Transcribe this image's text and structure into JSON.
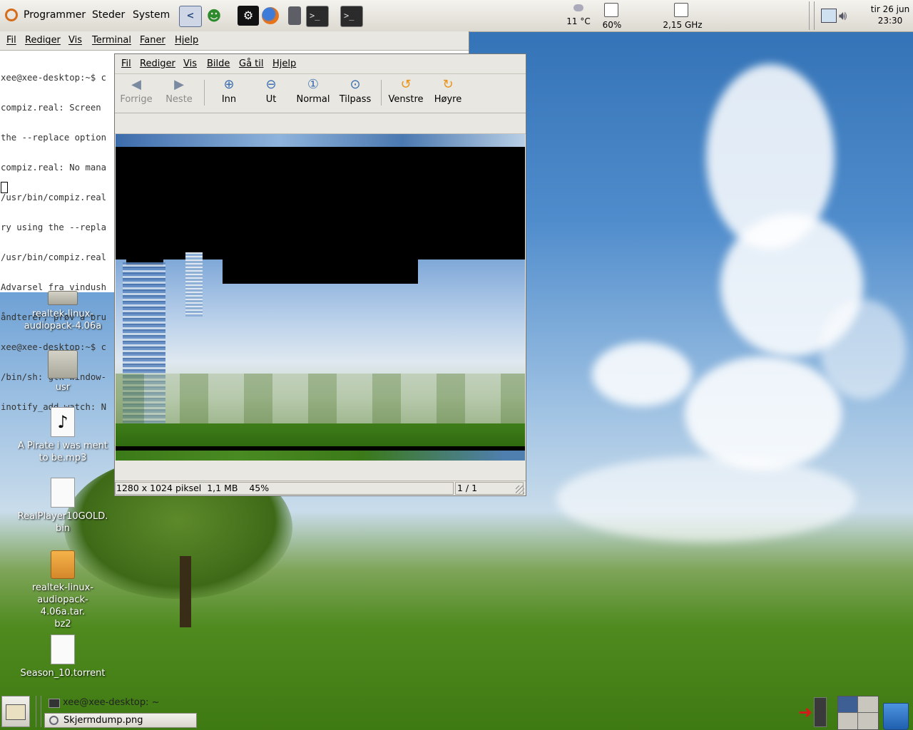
{
  "top_panel": {
    "menus": [
      "Programmer",
      "Steder",
      "System"
    ],
    "launchers": [
      "kde-icon",
      "messenger-icon",
      "steam-icon",
      "firefox-icon",
      "speaker-icon",
      "terminal-icon",
      "terminal-icon"
    ],
    "weather": "11 °C",
    "cpu_usage": "60%",
    "cpu_freq": "2,15 GHz",
    "date": "tir 26 jun",
    "time": "23:30"
  },
  "terminal": {
    "menus": [
      "Fil",
      "Rediger",
      "Vis",
      "Terminal",
      "Faner",
      "Hjelp"
    ],
    "lines": [
      "xee@xee-desktop:~$ c",
      "compiz.real: Screen ",
      "the --replace option",
      "compiz.real: No mana",
      "/usr/bin/compiz.real",
      "ry using the --repla",
      "/usr/bin/compiz.real",
      "Advarsel fra vindush",
      "åndterer; prøv å bru",
      "xee@xee-desktop:~$ c",
      "/bin/sh: gtk-window-",
      "inotify_add_watch: N"
    ]
  },
  "viewer": {
    "menus": [
      "Fil",
      "Rediger",
      "Vis",
      "Bilde",
      "Gå til",
      "Hjelp"
    ],
    "toolbar": {
      "previous": "Forrige",
      "next": "Neste",
      "zoom_in": "Inn",
      "zoom_out": "Ut",
      "normal": "Normal",
      "fit": "Tilpass",
      "rotate_left": "Venstre",
      "rotate_right": "Høyre"
    },
    "status": {
      "dimensions": "1280 x 1024 piksel",
      "size": "1,1 MB",
      "zoom": "45%",
      "page": "1 / 1"
    }
  },
  "desktop_icons": [
    {
      "label": "realtek-linux-\naudiopack-4.06a",
      "type": "folder"
    },
    {
      "label": "usr",
      "type": "folder"
    },
    {
      "label": "A Pirate i was ment\nto be.mp3",
      "type": "audio"
    },
    {
      "label": "RealPlayer10GOLD.\nbin",
      "type": "document"
    },
    {
      "label": "realtek-linux-\naudiopack-4.06a.tar.\nbz2",
      "type": "package"
    },
    {
      "label": "Season_10.torrent",
      "type": "document"
    }
  ],
  "taskbar": {
    "tasks": [
      "xee@xee-desktop: ~",
      "Skjermdump.png"
    ]
  },
  "colors": {
    "panel": "#e9e7e1",
    "sky": "#4f8ccc",
    "grass": "#4e8a1e"
  }
}
